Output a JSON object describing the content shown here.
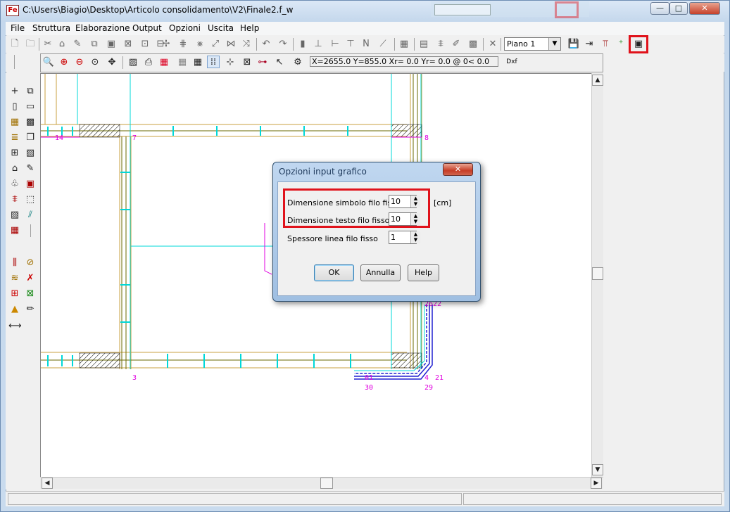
{
  "window": {
    "title": "C:\\Users\\Biagio\\Desktop\\Articolo consolidamento\\V2\\Finale2.f_w",
    "app_icon_text": "Fe",
    "minimize_glyph": "—",
    "maximize_glyph": "□",
    "close_glyph": "✕"
  },
  "menu": {
    "file": "File",
    "struttura": "Struttura",
    "elaborazione": "Elaborazione",
    "output": "Output",
    "opzioni": "Opzioni",
    "uscita": "Uscita",
    "help": "Help"
  },
  "toolbar": {
    "piano_select": "Piano 1",
    "coord_readout": "X=2655.0 Y=855.0 Xr=  0.0 Yr=  0.0 @  0<  0.0",
    "dxf_label": "Dxf"
  },
  "drawing": {
    "node_labels": [
      "14",
      "7",
      "8",
      "3",
      "01",
      "4",
      "21",
      "30",
      "29",
      "2622"
    ],
    "line_color": "#00d8d8",
    "wall_color": "#c8a040",
    "label_color": "#e000e0"
  },
  "dialog": {
    "title": "Opzioni input grafico",
    "close_glyph": "✕",
    "field1_label": "Dimensione simbolo filo fisso",
    "field1_value": "10",
    "field2_label": "Dimensione testo filo fisso",
    "field2_value": "10",
    "field3_label": "Spessore linea filo fisso",
    "field3_value": "1",
    "unit": "[cm]",
    "ok": "OK",
    "annulla": "Annulla",
    "help": "Help"
  },
  "colors": {
    "highlight_red": "#e0121b",
    "accent_blue": "#3c7fb1"
  }
}
